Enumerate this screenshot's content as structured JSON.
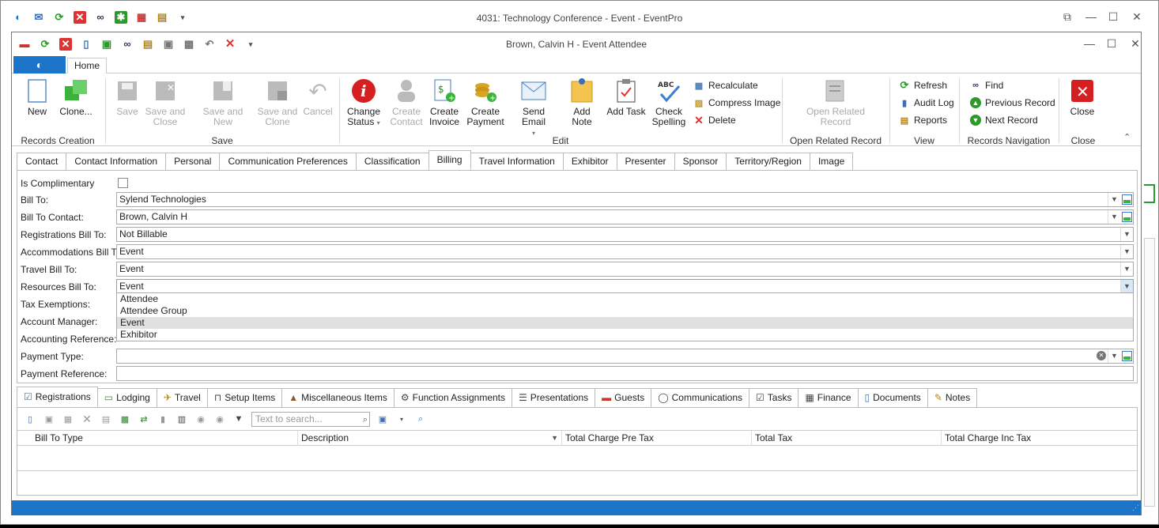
{
  "outer_window": {
    "title": "4031: Technology Conference - Event - EventPro",
    "controls": {
      "restore": "⧉",
      "minimize": "—",
      "maximize": "☐",
      "close": "✕"
    }
  },
  "inner_window": {
    "title": "Brown, Calvin H - Event Attendee",
    "controls": {
      "minimize": "—",
      "maximize": "☐",
      "close": "✕"
    }
  },
  "ribbon": {
    "tab_home": "Home",
    "groups": {
      "records_creation": "Records Creation",
      "save": "Save",
      "edit": "Edit",
      "open_related": "Open Related Record",
      "view": "View",
      "records_navigation": "Records Navigation",
      "close": "Close"
    },
    "buttons": {
      "new": "New",
      "clone": "Clone...",
      "save": "Save",
      "save_and_close_1": "Save and",
      "save_and_close_2": "Close",
      "save_and_new": "Save and New",
      "save_and_clone_1": "Save and",
      "save_and_clone_2": "Clone",
      "cancel": "Cancel",
      "change_status_1": "Change",
      "change_status_2": "Status",
      "create_contact_1": "Create",
      "create_contact_2": "Contact",
      "create_invoice_1": "Create",
      "create_invoice_2": "Invoice",
      "create_payment_1": "Create",
      "create_payment_2": "Payment",
      "send_email": "Send Email",
      "add_note": "Add Note",
      "add_task": "Add Task",
      "check_spelling_1": "Check",
      "check_spelling_2": "Spelling",
      "recalculate": "Recalculate",
      "compress_image": "Compress Image",
      "delete": "Delete",
      "open_related_1": "Open Related",
      "open_related_2": "Record",
      "refresh": "Refresh",
      "audit_log": "Audit Log",
      "reports": "Reports",
      "find": "Find",
      "previous_record": "Previous Record",
      "next_record": "Next Record",
      "close": "Close"
    }
  },
  "top_tabs": [
    "Contact",
    "Contact Information",
    "Personal",
    "Communication Preferences",
    "Classification",
    "Billing",
    "Travel Information",
    "Exhibitor",
    "Presenter",
    "Sponsor",
    "Territory/Region",
    "Image"
  ],
  "active_top_tab": "Billing",
  "form": {
    "is_complimentary_label": "Is Complimentary",
    "bill_to_label": "Bill To:",
    "bill_to_value": "Sylend Technologies",
    "bill_to_contact_label": "Bill To Contact:",
    "bill_to_contact_value": "Brown, Calvin H",
    "registrations_bill_to_label": "Registrations Bill To:",
    "registrations_bill_to_value": "Not Billable",
    "accommodations_bill_to_label": "Accommodations Bill To:",
    "accommodations_bill_to_value": "Event",
    "travel_bill_to_label": "Travel Bill To:",
    "travel_bill_to_value": "Event",
    "resources_bill_to_label": "Resources Bill To:",
    "resources_bill_to_value": "Event",
    "tax_exemptions_label": "Tax Exemptions:",
    "account_manager_label": "Account Manager:",
    "accounting_reference_label": "Accounting Reference:",
    "payment_type_label": "Payment Type:",
    "payment_reference_label": "Payment Reference:",
    "dropdown_options": [
      "Attendee",
      "Attendee Group",
      "Event",
      "Exhibitor"
    ],
    "dropdown_selected": "Event"
  },
  "bottom_tabs": [
    "Registrations",
    "Lodging",
    "Travel",
    "Setup Items",
    "Miscellaneous Items",
    "Function Assignments",
    "Presentations",
    "Guests",
    "Communications",
    "Tasks",
    "Finance",
    "Documents",
    "Notes"
  ],
  "active_bottom_tab": "Registrations",
  "grid": {
    "search_placeholder": "Text to search...",
    "columns": [
      "Bill To Type",
      "Description",
      "Total Charge Pre Tax",
      "Total Tax",
      "Total Charge Inc Tax"
    ]
  },
  "colors": {
    "accent": "#1c74c8",
    "status_bar": "#1c74c8"
  }
}
